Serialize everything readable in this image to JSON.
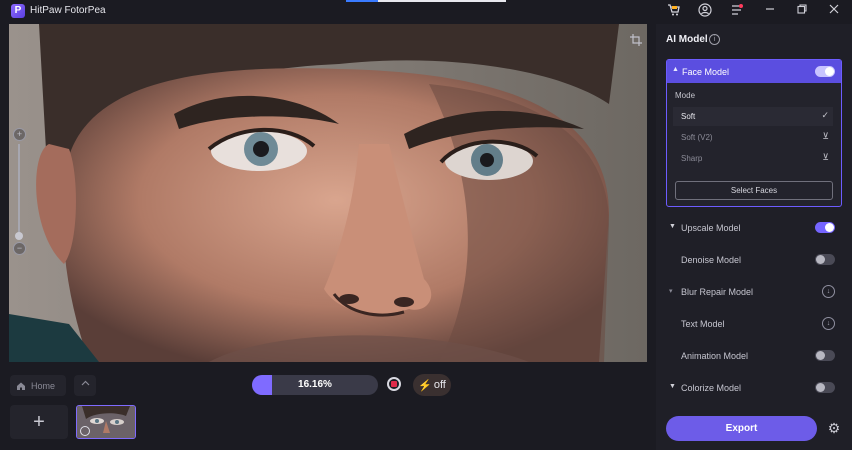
{
  "app": {
    "title": "HitPaw FotorPea",
    "logo_letter": "P"
  },
  "titlebar": {
    "icons": [
      "cart-icon",
      "account-icon",
      "menu-icon",
      "minimize-icon",
      "restore-icon",
      "close-icon"
    ]
  },
  "canvas": {
    "zoom_plus": "+",
    "zoom_minus": "−"
  },
  "bottom": {
    "home_label": "Home",
    "progress_text": "16.16%",
    "progress_value": 0.1616,
    "boost_label": "off",
    "add_label": "+"
  },
  "panel": {
    "title": "AI Model",
    "face_model": {
      "label": "Face Model",
      "enabled": true,
      "mode_label": "Mode",
      "options": [
        {
          "label": "Soft",
          "state": "selected"
        },
        {
          "label": "Soft (V2)",
          "state": "download"
        },
        {
          "label": "Sharp",
          "state": "download"
        }
      ],
      "select_faces_label": "Select Faces"
    },
    "models": [
      {
        "label": "Upscale Model",
        "control": "toggle-on",
        "caret": true
      },
      {
        "label": "Denoise Model",
        "control": "toggle-off",
        "caret": false
      },
      {
        "label": "Blur Repair Model",
        "control": "download",
        "caret": true
      },
      {
        "label": "Text Model",
        "control": "download",
        "caret": false
      },
      {
        "label": "Animation Model",
        "control": "toggle-off",
        "caret": false
      },
      {
        "label": "Colorize Model",
        "control": "toggle-off",
        "caret": true
      }
    ],
    "export_label": "Export"
  },
  "colors": {
    "accent": "#6d5ce8",
    "panel_bg": "#1f1f27",
    "app_bg": "#1b1b22"
  }
}
